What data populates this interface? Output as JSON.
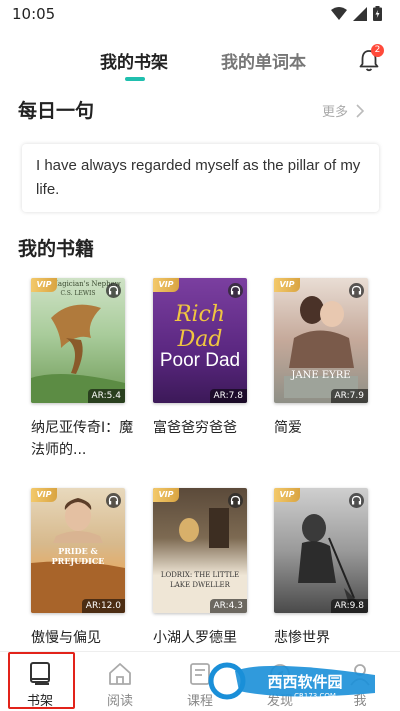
{
  "status_bar": {
    "time": "10:05"
  },
  "tabs": {
    "active": "我的书架",
    "inactive": "我的单词本"
  },
  "notifications": {
    "badge_count": "2"
  },
  "daily": {
    "title": "每日一句",
    "more": "更多",
    "quote": "I have always regarded myself as the pillar of my life."
  },
  "books_section": {
    "title": "我的书籍"
  },
  "books": [
    {
      "title": "纳尼亚传奇I：魔法师的...",
      "ar": "AR:5.4",
      "vip": "VIP",
      "cover_text": "The Magician's Nephew",
      "cover_author": "C.S. LEWIS"
    },
    {
      "title": "富爸爸穷爸爸",
      "ar": "AR:7.8",
      "vip": "VIP",
      "cover_text": "Rich Dad",
      "cover_text2": "Poor Dad"
    },
    {
      "title": "简爱",
      "ar": "AR:7.9",
      "vip": "VIP",
      "cover_text": "JANE EYRE"
    },
    {
      "title": "傲慢与偏见",
      "ar": "AR:12.0",
      "vip": "VIP",
      "cover_text": "PRIDE & PREJUDICE"
    },
    {
      "title": "小湖人罗德里",
      "ar": "AR:4.3",
      "vip": "VIP",
      "cover_text": "LODRIX: THE LITTLE LAKE DWELLER"
    },
    {
      "title": "悲惨世界",
      "ar": "AR:9.8",
      "vip": "VIP"
    }
  ],
  "bottom_nav": [
    {
      "label": "书架",
      "icon": "book-icon"
    },
    {
      "label": "阅读",
      "icon": "home-icon"
    },
    {
      "label": "课程",
      "icon": "course-icon"
    },
    {
      "label": "发现",
      "icon": "discover-icon"
    },
    {
      "label": "我",
      "icon": "profile-icon"
    }
  ],
  "watermark": {
    "text": "西西软件园",
    "sub": "CR173.COM"
  },
  "colors": {
    "accent": "#20bfae",
    "badge": "#ff4a3a",
    "highlight": "#e2231a",
    "vip": "#e0b052"
  }
}
